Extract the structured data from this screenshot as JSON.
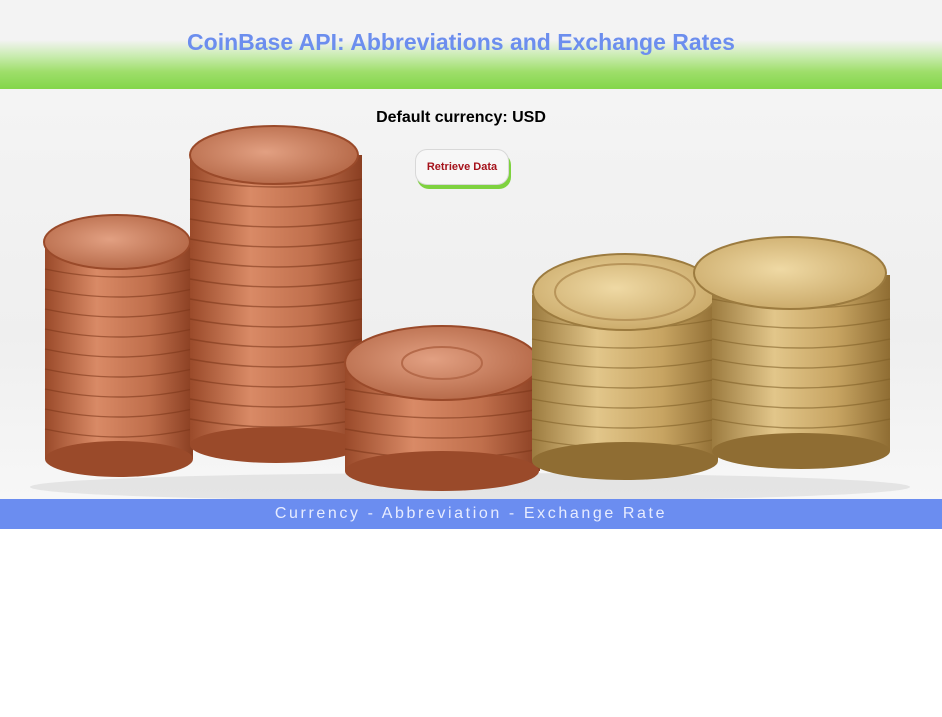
{
  "header": {
    "title": "CoinBase API: Abbreviations and Exchange Rates"
  },
  "main": {
    "default_currency_label": "Default currency: USD",
    "retrieve_button_label": "Retrieve Data"
  },
  "table": {
    "header_label": "Currency - Abbreviation - Exchange Rate"
  },
  "colors": {
    "title": "#6c8eee",
    "header_gradient_end": "#83d64a",
    "table_header_bg": "#6b8df0",
    "button_text": "#a5121b"
  }
}
